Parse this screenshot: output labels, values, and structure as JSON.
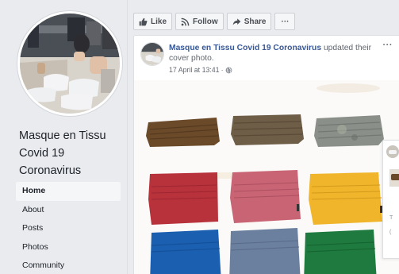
{
  "sidebar": {
    "page_name": "Masque en Tissu Covid 19 Coronavirus",
    "nav": [
      {
        "label": "Home",
        "active": true
      },
      {
        "label": "About",
        "active": false
      },
      {
        "label": "Posts",
        "active": false
      },
      {
        "label": "Photos",
        "active": false
      },
      {
        "label": "Community",
        "active": false
      }
    ]
  },
  "actions": {
    "like": "Like",
    "follow": "Follow",
    "share": "Share",
    "more": "···"
  },
  "post": {
    "author": "Masque en Tissu Covid 19 Coronavirus",
    "action_text": " updated their cover photo.",
    "timestamp": "17 April at 13:41",
    "separator": "·",
    "privacy_icon": "globe-icon",
    "more": "···"
  },
  "overlay": {
    "text_1": "T",
    "text_2": "("
  },
  "colors": {
    "link": "#385898",
    "background": "#e9ebee",
    "masks": [
      "#6b4a2a",
      "#6e5d47",
      "#8a8f8a",
      "#b8323c",
      "#c96474",
      "#f0b52a",
      "#1a5fb0",
      "#6b7f9e",
      "#1e7a3e"
    ]
  }
}
